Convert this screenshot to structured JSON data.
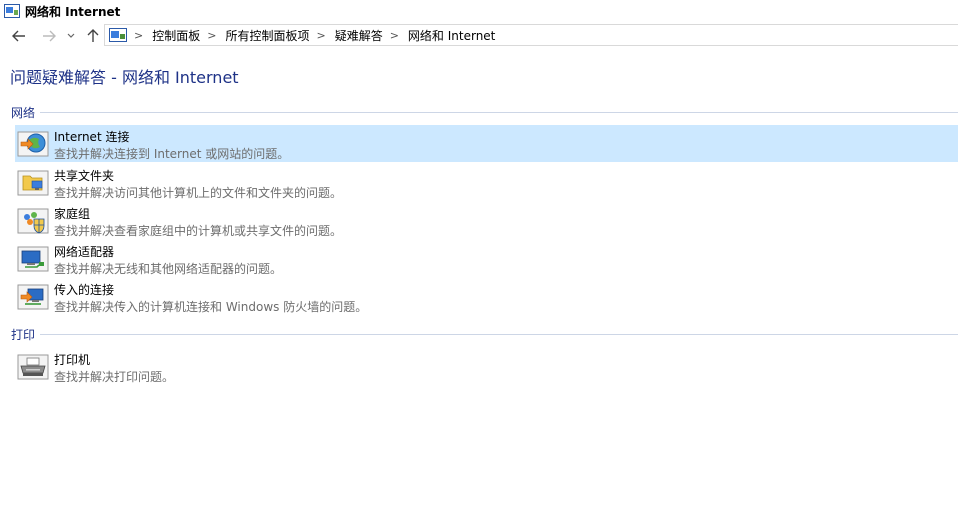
{
  "window": {
    "title": "网络和 Internet"
  },
  "nav": {
    "back_icon": "back-arrow-icon",
    "forward_icon": "forward-arrow-icon",
    "recent_icon": "chevron-down-icon",
    "up_icon": "up-arrow-icon"
  },
  "breadcrumb": [
    "控制面板",
    "所有控制面板项",
    "疑难解答",
    "网络和 Internet"
  ],
  "page": {
    "title": "问题疑难解答 - 网络和 Internet"
  },
  "sections": [
    {
      "label": "网络",
      "items": [
        {
          "name": "Internet 连接",
          "desc": "查找并解决连接到 Internet 或网站的问题。",
          "icon": "internet-connection-icon"
        },
        {
          "name": "共享文件夹",
          "desc": "查找并解决访问其他计算机上的文件和文件夹的问题。",
          "icon": "shared-folder-icon"
        },
        {
          "name": "家庭组",
          "desc": "查找并解决查看家庭组中的计算机或共享文件的问题。",
          "icon": "homegroup-icon"
        },
        {
          "name": "网络适配器",
          "desc": "查找并解决无线和其他网络适配器的问题。",
          "icon": "network-adapter-icon"
        },
        {
          "name": "传入的连接",
          "desc": "查找并解决传入的计算机连接和 Windows 防火墙的问题。",
          "icon": "incoming-connections-icon"
        }
      ]
    },
    {
      "label": "打印",
      "items": [
        {
          "name": "打印机",
          "desc": "查找并解决打印问题。",
          "icon": "printer-icon"
        }
      ]
    }
  ],
  "colors": {
    "title": "#1e3287",
    "selected": "#cce8ff",
    "desc": "#6d6d6d"
  }
}
